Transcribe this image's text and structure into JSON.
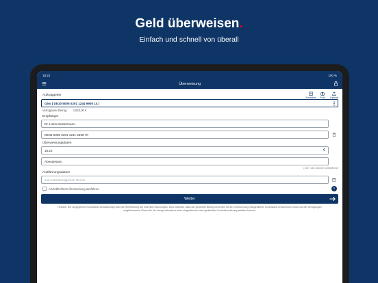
{
  "promo": {
    "title": "Geld überweisen",
    "title_dot": ".",
    "subtitle": "Einfach und schnell von überall"
  },
  "status_bar": {
    "time": "18:22",
    "battery": "100 %"
  },
  "nav": {
    "title": "Überweisung",
    "menu_icon": "menu-icon",
    "lock_icon": "lock-icon"
  },
  "auftraggeber": {
    "label": "Auftraggeber",
    "account_value": "Giro ( DE10 5005 0201 1244 9900 14 )",
    "tools": [
      {
        "label": "Kontakte",
        "icon": "contacts-icon"
      },
      {
        "label": "Foto",
        "icon": "camera-icon"
      },
      {
        "label": "Upload",
        "icon": "upload-icon"
      }
    ],
    "balance_label": "Verfügbarer Betrag:",
    "balance_value": "3.820,00 €"
  },
  "empfaenger": {
    "label": "Empfänger",
    "name_value": "Dr. Hans Mustermann",
    "iban_value": "DE45 5005 0201 1241 5398 70"
  },
  "ueberweisungsdaten": {
    "label": "Überweisungsdaten",
    "amount_value": "18,22",
    "currency_symbol": "€",
    "purpose_value": "Abendessen",
    "char_counter": "(130 / 140 Zeichen verbleibend)"
  },
  "ausfuehrung": {
    "label": "Ausführungsdatum",
    "date_placeholder": "zum nächstmöglichen Termin",
    "eilueberweisung_label": "Als Eil/Echtzeit-Überweisung ausführen",
    "info_glyph": "i"
  },
  "submit": {
    "label": "Weiter"
  },
  "hint": {
    "text": "Hinweis: Der angegebene Kontostand berücksichtigt nicht die Wertstellung der einzelnen Buchungen. Dies bedeutet, dass der genannte Betrag nicht dem für die Zinsrechnung maßgeblichen Kontostand entsprechen muss und bei Verfügungen möglicherweise Zinsen für die Inanspruchnahme einer eingeräumten oder geduldeten Kontoüberziehung anfallen können."
  },
  "colors": {
    "brand": "#0e3566",
    "accent": "#e3002b"
  }
}
